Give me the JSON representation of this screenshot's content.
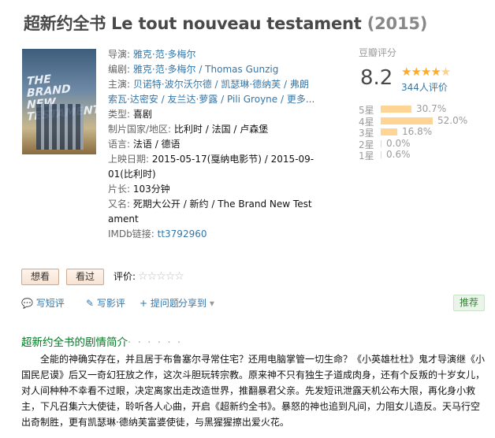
{
  "title": {
    "main": "超新约全书 Le tout nouveau testament",
    "year": "(2015)"
  },
  "poster": {
    "alt_text": "THE BRAND NEW TESTAMENT"
  },
  "info": {
    "director": {
      "label": "导演:",
      "value": "雅克·范·多梅尔"
    },
    "writer": {
      "label": "编剧:",
      "value": "雅克·范·多梅尔 / Thomas Gunzig"
    },
    "cast": {
      "label": "主演:",
      "line1": "贝诺特·波尔沃尔德 / 凯瑟琳·德纳芙 / 弗朗",
      "line2": "索瓦·达密安 / 友兰达·萝露 / Pili Groyne / 更多..."
    },
    "genre": {
      "label": "类型:",
      "value": "喜剧"
    },
    "country": {
      "label": "制片国家/地区:",
      "value": "比利时 / 法国 / 卢森堡"
    },
    "language": {
      "label": "语言:",
      "value": "法语 / 德语"
    },
    "release": {
      "label": "上映日期:",
      "line1": "2015-05-17(戛纳电影节) / 2015-09-",
      "line2": "01(比利时)"
    },
    "runtime": {
      "label": "片长:",
      "value": "103分钟"
    },
    "aka": {
      "label": "又名:",
      "line1": "死期大公开 / 新约 / The Brand New Test",
      "line2": "ament"
    },
    "imdb": {
      "label": "IMDb链接:",
      "value": "tt3792960"
    }
  },
  "rating": {
    "label": "豆瓣评分",
    "score": "8.2",
    "votes": "344人评价",
    "distribution": [
      {
        "label": "5星",
        "pct": "30.7%",
        "value": 30.7
      },
      {
        "label": "4星",
        "pct": "52.0%",
        "value": 52.0
      },
      {
        "label": "3星",
        "pct": "16.8%",
        "value": 16.8
      },
      {
        "label": "2星",
        "pct": "0.0%",
        "value": 0.0
      },
      {
        "label": "1星",
        "pct": "0.6%",
        "value": 0.6
      }
    ]
  },
  "buttons": {
    "want": "想看",
    "seen": "看过"
  },
  "rate_label": "评价:",
  "actions": {
    "short_review": "写短评",
    "review": "写影评",
    "question": "提问题",
    "share": "分享到"
  },
  "recommend": "推荐",
  "summary": {
    "heading": "超新约全书的剧情简介",
    "dots": "· · · · · ·",
    "text": "全能的神确实存在，并且居于布鲁塞尔寻常住宅？还用电脑掌管一切生命？《小英雄杜杜》鬼才导演继《小国民尼谟》后又一奇幻狂放之作，这次斗胆玩转宗教。原来神不只有独生子道成肉身，还有个反叛的十岁女儿，对人间种种不幸看不过眼，决定离家出走改造世界，推翻暴君父亲。先发短讯泄露天机公布大限，再化身小救主，下凡召集六大使徒，聆听各人心曲，开启《超新约全书》。暴怒的神也追到凡间，力阻女儿造反。天马行空出奇制胜，更有凯瑟琳·德纳芙富婆使徒，与黑猩猩擦出爱火花。"
  },
  "colors": {
    "link": "#3377aa",
    "green": "#007722",
    "star": "#ffac2d",
    "bar": "#ffd596"
  }
}
